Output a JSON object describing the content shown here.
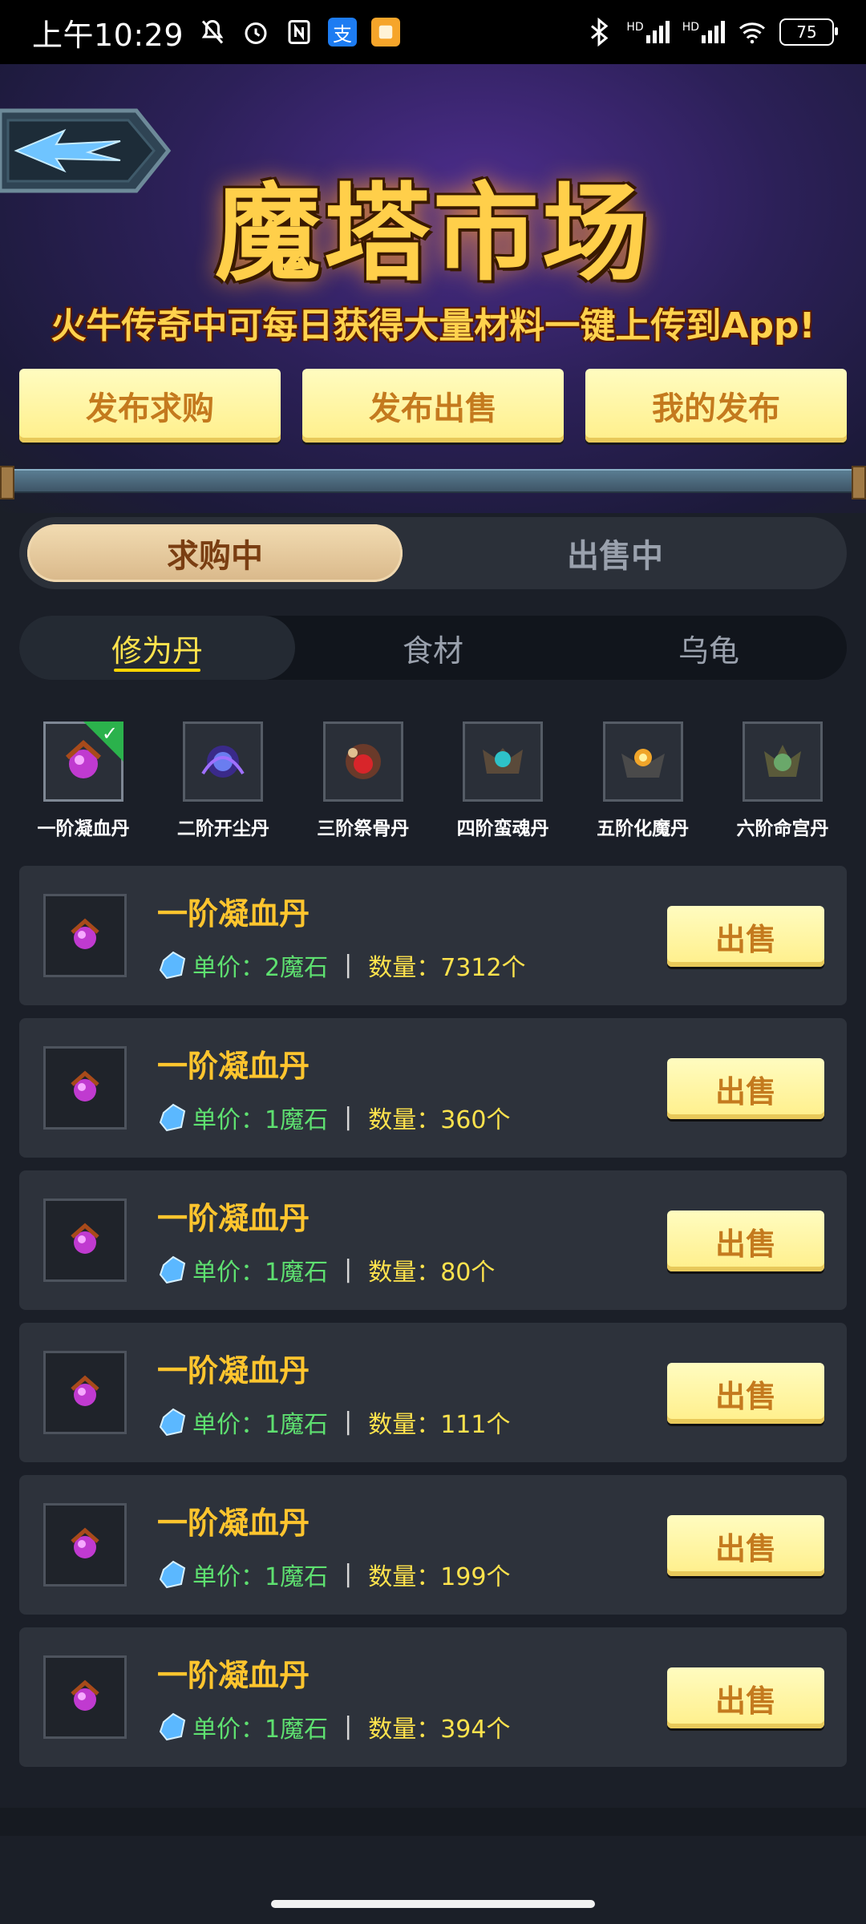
{
  "status_bar": {
    "time": "上午10:29",
    "icons": [
      "bell-off-icon",
      "alarm-icon",
      "nfc-icon",
      "alipay-icon",
      "notes-icon"
    ],
    "right_icons": [
      "bluetooth-icon",
      "signal-hd-icon",
      "signal-hd-icon",
      "wifi-icon",
      "battery-icon"
    ],
    "hd1": "HD",
    "hd2": "HD",
    "battery": "75",
    "alipay_glyph": "支"
  },
  "header": {
    "title": "魔塔市场",
    "subtitle": "火牛传奇中可每日获得大量材料一键上传到App!",
    "back_icon": "back-arrow-icon"
  },
  "actions": {
    "post_buy": "发布求购",
    "post_sell": "发布出售",
    "my_posts": "我的发布"
  },
  "mode_tabs": {
    "buying": "求购中",
    "selling": "出售中",
    "active": "buying"
  },
  "category_tabs": {
    "items": [
      "修为丹",
      "食材",
      "乌龟"
    ],
    "active": 0
  },
  "item_selector": [
    {
      "label": "一阶凝血丹",
      "selected": true,
      "color": "#c03ad0"
    },
    {
      "label": "二阶开尘丹",
      "selected": false,
      "color": "#6a4de8"
    },
    {
      "label": "三阶祭骨丹",
      "selected": false,
      "color": "#d8452a"
    },
    {
      "label": "四阶蛮魂丹",
      "selected": false,
      "color": "#2ec2c8"
    },
    {
      "label": "五阶化魔丹",
      "selected": false,
      "color": "#f0a52a"
    },
    {
      "label": "六阶命宫丹",
      "selected": false,
      "color": "#6aa86a"
    }
  ],
  "listings": [
    {
      "name": "一阶凝血丹",
      "price_label": "单价：",
      "price": "2魔石",
      "qty_label": "数量：",
      "qty": "7312个",
      "button": "出售"
    },
    {
      "name": "一阶凝血丹",
      "price_label": "单价：",
      "price": "1魔石",
      "qty_label": "数量：",
      "qty": "360个",
      "button": "出售"
    },
    {
      "name": "一阶凝血丹",
      "price_label": "单价：",
      "price": "1魔石",
      "qty_label": "数量：",
      "qty": "80个",
      "button": "出售"
    },
    {
      "name": "一阶凝血丹",
      "price_label": "单价：",
      "price": "1魔石",
      "qty_label": "数量：",
      "qty": "111个",
      "button": "出售"
    },
    {
      "name": "一阶凝血丹",
      "price_label": "单价：",
      "price": "1魔石",
      "qty_label": "数量：",
      "qty": "199个",
      "button": "出售"
    },
    {
      "name": "一阶凝血丹",
      "price_label": "单价：",
      "price": "1魔石",
      "qty_label": "数量：",
      "qty": "394个",
      "button": "出售"
    }
  ],
  "separator": "|",
  "checkmark": "✓"
}
